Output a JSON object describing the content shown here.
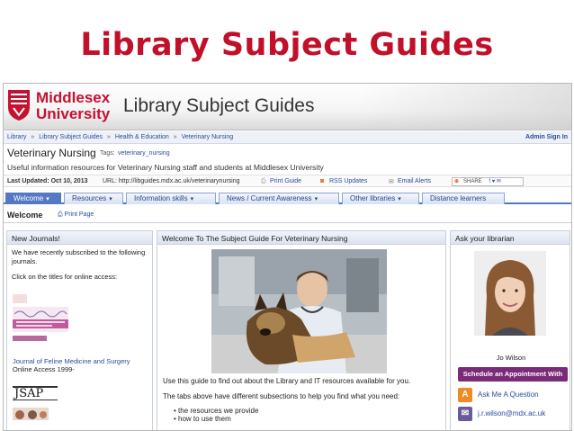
{
  "slide": {
    "title": "Library Subject Guides"
  },
  "banner": {
    "uni_line1": "Middlesex",
    "uni_line2": "University",
    "title": "Library Subject Guides"
  },
  "breadcrumb": {
    "items": [
      "Library",
      "Library Subject Guides",
      "Health & Education",
      "Veterinary Nursing"
    ],
    "separator": "»",
    "admin_link": "Admin Sign In"
  },
  "guide": {
    "name": "Veterinary Nursing",
    "tags_label": "Tags:",
    "tags_value": "veterinary_nursing",
    "description": "Useful information resources for Veterinary Nursing staff and students at Middlesex University"
  },
  "infobar": {
    "last_updated": "Last Updated: Oct 10, 2013",
    "url": "URL: http://libguides.mdx.ac.uk/veterinarynursing",
    "print_guide": "Print Guide",
    "rss": "RSS Updates",
    "email_alerts": "Email Alerts",
    "share": "SHARE"
  },
  "tabs": [
    {
      "label": "Welcome",
      "active": true
    },
    {
      "label": "Resources",
      "active": false
    },
    {
      "label": "Information skills",
      "active": false
    },
    {
      "label": "News / Current Awareness",
      "active": false
    },
    {
      "label": "Other libraries",
      "active": false
    },
    {
      "label": "Distance learners",
      "active": false
    }
  ],
  "subbar": {
    "welcome": "Welcome",
    "print_page": "Print Page"
  },
  "left_box": {
    "title": "New Journals!",
    "intro": "We have recently subscribed to the following journals.",
    "click_text": "Click on the titles for online access:",
    "journal1_title": "Journal of Feline Medicine and Surgery",
    "journal1_access": "Online Access 1999-",
    "journal2_abbrev": "JSAP"
  },
  "center_box": {
    "title": "Welcome To The Subject Guide For Veterinary Nursing",
    "para1": "Use this guide to find out about the Library and IT resources available for you.",
    "para2": "The tabs above have different subsections to help you find what you need:",
    "bullets": [
      "the resources we provide",
      "how to use them"
    ]
  },
  "right_box": {
    "title": "Ask your librarian",
    "name": "Jo Wilson",
    "appointment": "Schedule an Appointment With Me",
    "ask": "Ask Me A Question",
    "email": "j.r.wilson@mdx.ac.uk"
  },
  "colors": {
    "title_red": "#c0102a",
    "tab_blue": "#5478c4",
    "link_blue": "#2a4d9b",
    "appointment_purple": "#7a2a78",
    "ask_orange": "#f08a24",
    "email_purple": "#6a5a9b"
  }
}
